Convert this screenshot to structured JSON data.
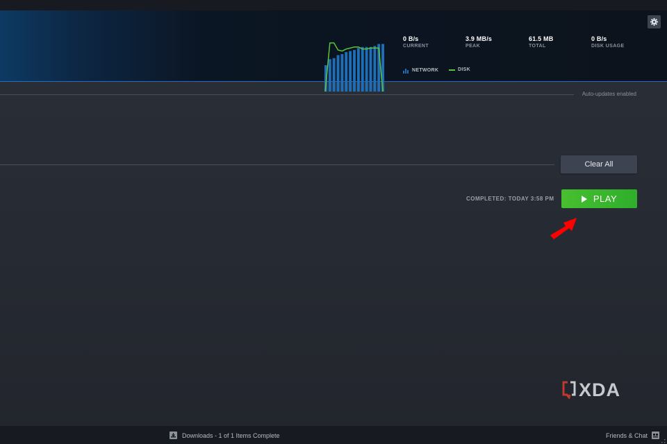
{
  "header": {
    "stats": [
      {
        "value": "0 B/s",
        "label": "CURRENT"
      },
      {
        "value": "3.9 MB/s",
        "label": "PEAK"
      },
      {
        "value": "61.5 MB",
        "label": "TOTAL"
      },
      {
        "value": "0 B/s",
        "label": "DISK USAGE"
      }
    ],
    "legend": {
      "network_label": "NETWORK",
      "disk_label": "DISK"
    },
    "settings_icon": "gear-icon"
  },
  "colors": {
    "network": "#1e6fb7",
    "disk": "#5ac43b",
    "accent_blue": "#1f6dc4",
    "play_green": "#47bf2f",
    "arrow_red": "#ff0000"
  },
  "graph": {
    "network_bars": [
      0.52,
      0.64,
      0.66,
      0.72,
      0.74,
      0.78,
      0.8,
      0.82,
      0.86,
      0.88,
      0.88,
      0.88,
      0.9,
      0.94,
      0.94
    ],
    "disk_line": [
      0,
      0.96,
      0.96,
      0.82,
      0.8,
      0.84,
      0.86,
      0.88,
      0.88,
      0.84,
      0.84,
      0.86,
      0.86,
      0.86,
      0
    ],
    "total_peak_mbps": "3.9"
  },
  "queue": {
    "auto_updates_text": "Auto-updates enabled"
  },
  "completed_section": {
    "clear_all_label": "Clear All",
    "completed_text": "COMPLETED: TODAY 3:58 PM",
    "play_label": "PLAY"
  },
  "watermark": {
    "text": "XDA"
  },
  "footer": {
    "downloads_text": "Downloads - 1 of 1 Items Complete",
    "friends_text": "Friends & Chat"
  }
}
